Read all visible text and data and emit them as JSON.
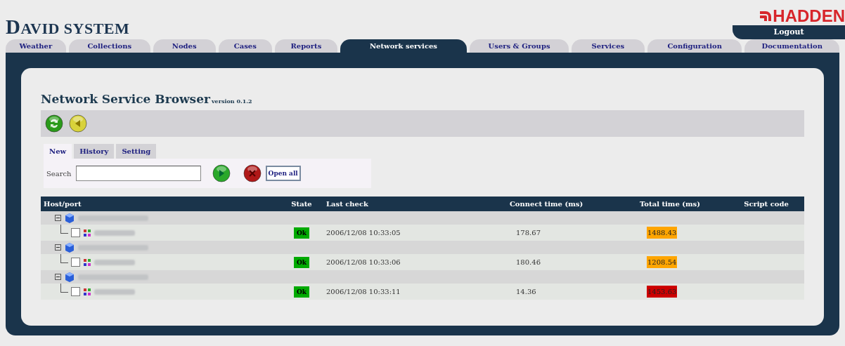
{
  "header": {
    "title": "DAVID SYSTEM",
    "logo": "HADDEN",
    "logout": "Logout"
  },
  "tabs": [
    {
      "label": "Weather",
      "selected": false
    },
    {
      "label": "Collections",
      "selected": false
    },
    {
      "label": "Nodes",
      "selected": false
    },
    {
      "label": "Cases",
      "selected": false
    },
    {
      "label": "Reports",
      "selected": false
    },
    {
      "label": "Network services",
      "selected": true
    },
    {
      "label": "Users & Groups",
      "selected": false
    },
    {
      "label": "Services",
      "selected": false
    },
    {
      "label": "Configuration",
      "selected": false
    },
    {
      "label": "Documentation",
      "selected": false
    }
  ],
  "browser": {
    "title": "Network Service Browser",
    "version": "version 0.1.2",
    "subtabs": [
      {
        "label": "New",
        "selected": true
      },
      {
        "label": "History",
        "selected": false
      },
      {
        "label": "Setting",
        "selected": false
      }
    ],
    "search": {
      "label": "Search",
      "button": "Open all"
    },
    "table": {
      "columns": [
        "Host/port",
        "State",
        "Last check",
        "Connect time (ms)",
        "Total time (ms)",
        "Script code"
      ],
      "groups": [
        {
          "expanded": true,
          "children": [
            {
              "checked": false,
              "state": "Ok",
              "last_check": "2006/12/08 10:33:05",
              "connect": "178.67",
              "total": "1488.43",
              "color": "#ffa500"
            }
          ]
        },
        {
          "expanded": true,
          "children": [
            {
              "checked": false,
              "state": "Ok",
              "last_check": "2006/12/08 10:33:06",
              "connect": "180.46",
              "total": "1208.54",
              "color": "#ffa500"
            }
          ]
        },
        {
          "expanded": true,
          "children": [
            {
              "checked": false,
              "state": "Ok",
              "last_check": "2006/12/08 10:33:11",
              "connect": "14.36",
              "total": "1453.63",
              "color": "#cc0000"
            }
          ]
        }
      ]
    }
  }
}
